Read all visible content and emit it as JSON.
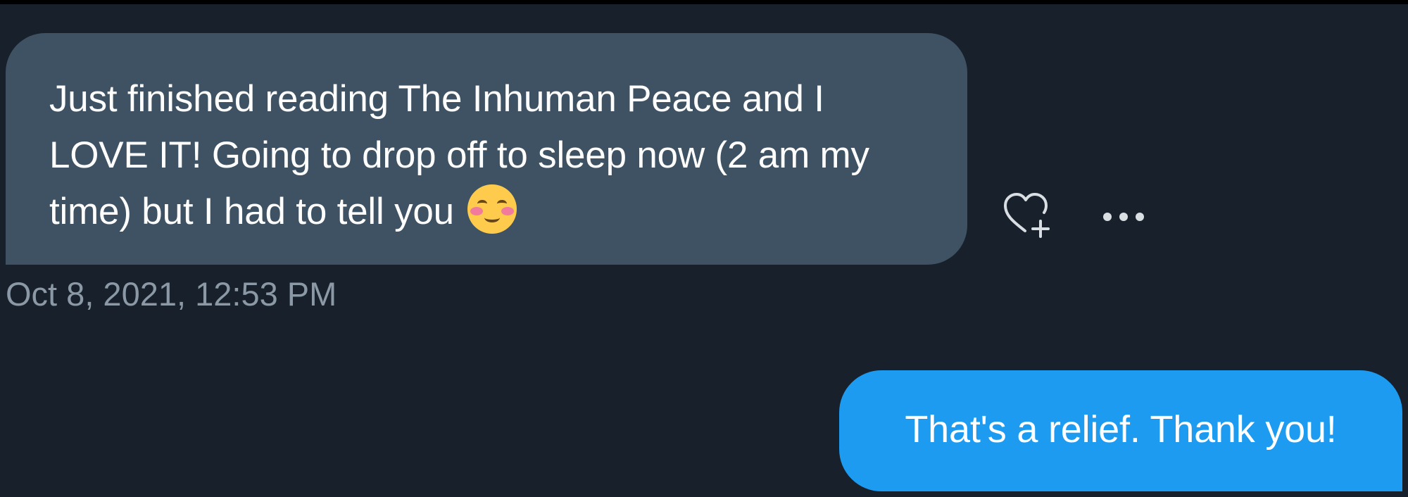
{
  "conversation": {
    "received_message": {
      "text": "Just finished reading The Inhuman Peace and I LOVE IT! Going to drop off to sleep now (2 am my time) but I had to tell you",
      "emoji": "smiling-face-with-blushing-eyes",
      "timestamp": "Oct 8, 2021, 12:53 PM",
      "actions": {
        "react_icon": "heart-plus-icon",
        "more_icon": "more-horizontal-icon"
      }
    },
    "sent_message": {
      "text": "That's a relief. Thank you!"
    }
  },
  "colors": {
    "background": "#17202b",
    "received_bubble": "#3e5263",
    "sent_bubble": "#1d9bf0",
    "timestamp": "#8b98a5",
    "icon": "#d9dee3"
  }
}
